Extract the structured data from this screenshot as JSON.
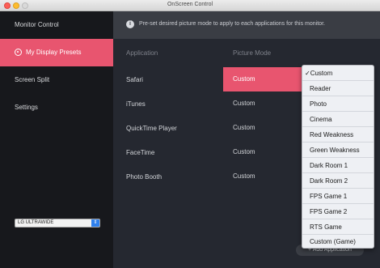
{
  "window": {
    "title": "OnScreen Control"
  },
  "sidebar": {
    "items": [
      {
        "label": "Monitor Control"
      },
      {
        "label": "My Display Presets"
      },
      {
        "label": "Screen Split"
      },
      {
        "label": "Settings"
      }
    ],
    "active_index": 1,
    "monitor_select": {
      "value": "LG ULTRAWIDE"
    }
  },
  "main": {
    "info_icon": "info-icon",
    "info_text": "Pre-set desired picture mode to apply to each applications for this monitor.",
    "columns": {
      "application": "Application",
      "picture_mode": "Picture Mode"
    },
    "rows": [
      {
        "app": "Safari",
        "mode": "Custom"
      },
      {
        "app": "iTunes",
        "mode": "Custom"
      },
      {
        "app": "QuickTime Player",
        "mode": "Custom"
      },
      {
        "app": "FaceTime",
        "mode": "Custom"
      },
      {
        "app": "Photo Booth",
        "mode": "Custom"
      }
    ],
    "selected_row": 0,
    "add_button": "Add Application"
  },
  "dropdown": {
    "check_mark": "✓",
    "selected": "Custom",
    "options": [
      "Custom",
      "Reader",
      "Photo",
      "Cinema",
      "Red Weakness",
      "Green Weakness",
      "Dark Room 1",
      "Dark Room 2",
      "FPS Game 1",
      "FPS Game 2",
      "RTS Game",
      "Custom (Game)"
    ]
  },
  "colors": {
    "accent": "#e8556f",
    "sidebar": "#17181c",
    "main": "#252830"
  }
}
